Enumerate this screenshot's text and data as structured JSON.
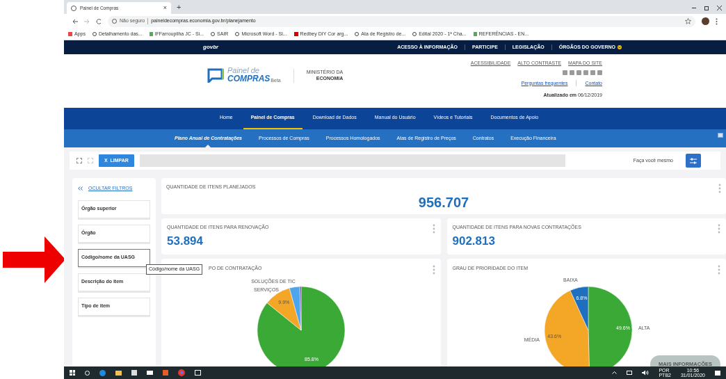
{
  "browser": {
    "tab": {
      "title": "Painel de Compras",
      "close": "×",
      "new_tab": "+"
    },
    "address": {
      "security": "Não seguro",
      "url": "paineldecompras.economia.gov.br/planejamento"
    },
    "bookmarks": [
      "Apps",
      "Detalhamento das...",
      "IFFarroupilha JC - Si...",
      "SAIR",
      "Microsoft Word - Sl...",
      "Redbey DIY Cor arg...",
      "Ata de Registro de...",
      "Edital 2020 - 1ª Cha...",
      "REFERÊNCIAS - EN..."
    ]
  },
  "gov_bar": {
    "logo": "govbr",
    "links": [
      "ACESSO À INFORMAÇÃO",
      "PARTICIPE",
      "LEGISLAÇÃO",
      "ÓRGÃOS DO GOVERNO"
    ]
  },
  "header": {
    "logo_top": "Painel de",
    "logo_bottom": "COMPRAS",
    "logo_badge": "Beta",
    "ministry_top": "MINISTÉRIO DA",
    "ministry_bottom": "ECONOMIA",
    "utility_links": [
      "ACESSIBILIDADE",
      "ALTO CONTRASTE",
      "MAPA DO SITE"
    ],
    "help_links": [
      "Perguntas frequentes",
      "Contato"
    ],
    "updated": "**Atualizado em** 06/12/2019"
  },
  "nav": [
    {
      "label": "Home",
      "selected": false
    },
    {
      "label": "Painel de Compras",
      "selected": true
    },
    {
      "label": "Download de Dados",
      "selected": false
    },
    {
      "label": "Manual do Usuário",
      "selected": false
    },
    {
      "label": "Vídeos e Tutoriais",
      "selected": false
    },
    {
      "label": "Documentos de Apoio",
      "selected": false
    }
  ],
  "subnav": [
    {
      "label": "Plano Anual de Contratações",
      "selected": true
    },
    {
      "label": "Processos de Compras",
      "selected": false
    },
    {
      "label": "Processos Homologados",
      "selected": false
    },
    {
      "label": "Atas de Registro de Preços",
      "selected": false
    },
    {
      "label": "Contratos",
      "selected": false
    },
    {
      "label": "Execução Financeira",
      "selected": false
    }
  ],
  "toolbar": {
    "clear_button": "X  LIMPAR",
    "self_service": "Faça você mesmo"
  },
  "filters": {
    "hide_link": "OCULTAR FILTROS",
    "items": [
      {
        "label": "Órgão superior",
        "hovered": false
      },
      {
        "label": "Órgão",
        "hovered": false
      },
      {
        "label": "Código/nome da UASG",
        "hovered": true
      },
      {
        "label": "Descrição do item",
        "hovered": false
      },
      {
        "label": "Tipo de item",
        "hovered": false
      }
    ],
    "tooltip": "Código/nome da UASG"
  },
  "kpis": [
    {
      "title": "QUANTIDADE DE ITENS PLANEJADOS",
      "value": "956.707"
    },
    {
      "title": "QUANTIDADE DE ITENS PARA RENOVAÇÃO",
      "value": "53.894"
    },
    {
      "title": "QUANTIDADE DE ITENS PARA NOVAS CONTRATAÇÕES",
      "value": "902.813"
    }
  ],
  "charts": [
    {
      "title": "PO DE CONTRATAÇÃO",
      "chart_data": {
        "type": "pie",
        "categories": [
          null,
          "SERVIÇOS",
          "SOLUÇÕES DE TIC",
          null
        ],
        "values": [
          85.8,
          9.9,
          3.8,
          0.5
        ],
        "colors": [
          "#3aa935",
          "#f4a627",
          "#4ea5ec",
          "#7b3fa0"
        ],
        "value_labels": [
          "85.8%",
          "9.9%",
          null,
          null
        ]
      }
    },
    {
      "title": "GRAU DE PRIORIDADE DO ITEM",
      "chart_data": {
        "type": "pie",
        "categories": [
          "ALTA",
          "MÉDIA",
          "BAIXA"
        ],
        "values": [
          49.6,
          43.6,
          6.8
        ],
        "colors": [
          "#3aa935",
          "#f4a627",
          "#1f6fbf"
        ],
        "value_labels": [
          "49.6%",
          "43.6%",
          "6.8%"
        ]
      }
    }
  ],
  "more_button": "MAIS INFORMAÇÕES",
  "taskbar": {
    "language": "POR",
    "layout": "PTB2",
    "time": "10:56",
    "date": "31/01/2020"
  }
}
